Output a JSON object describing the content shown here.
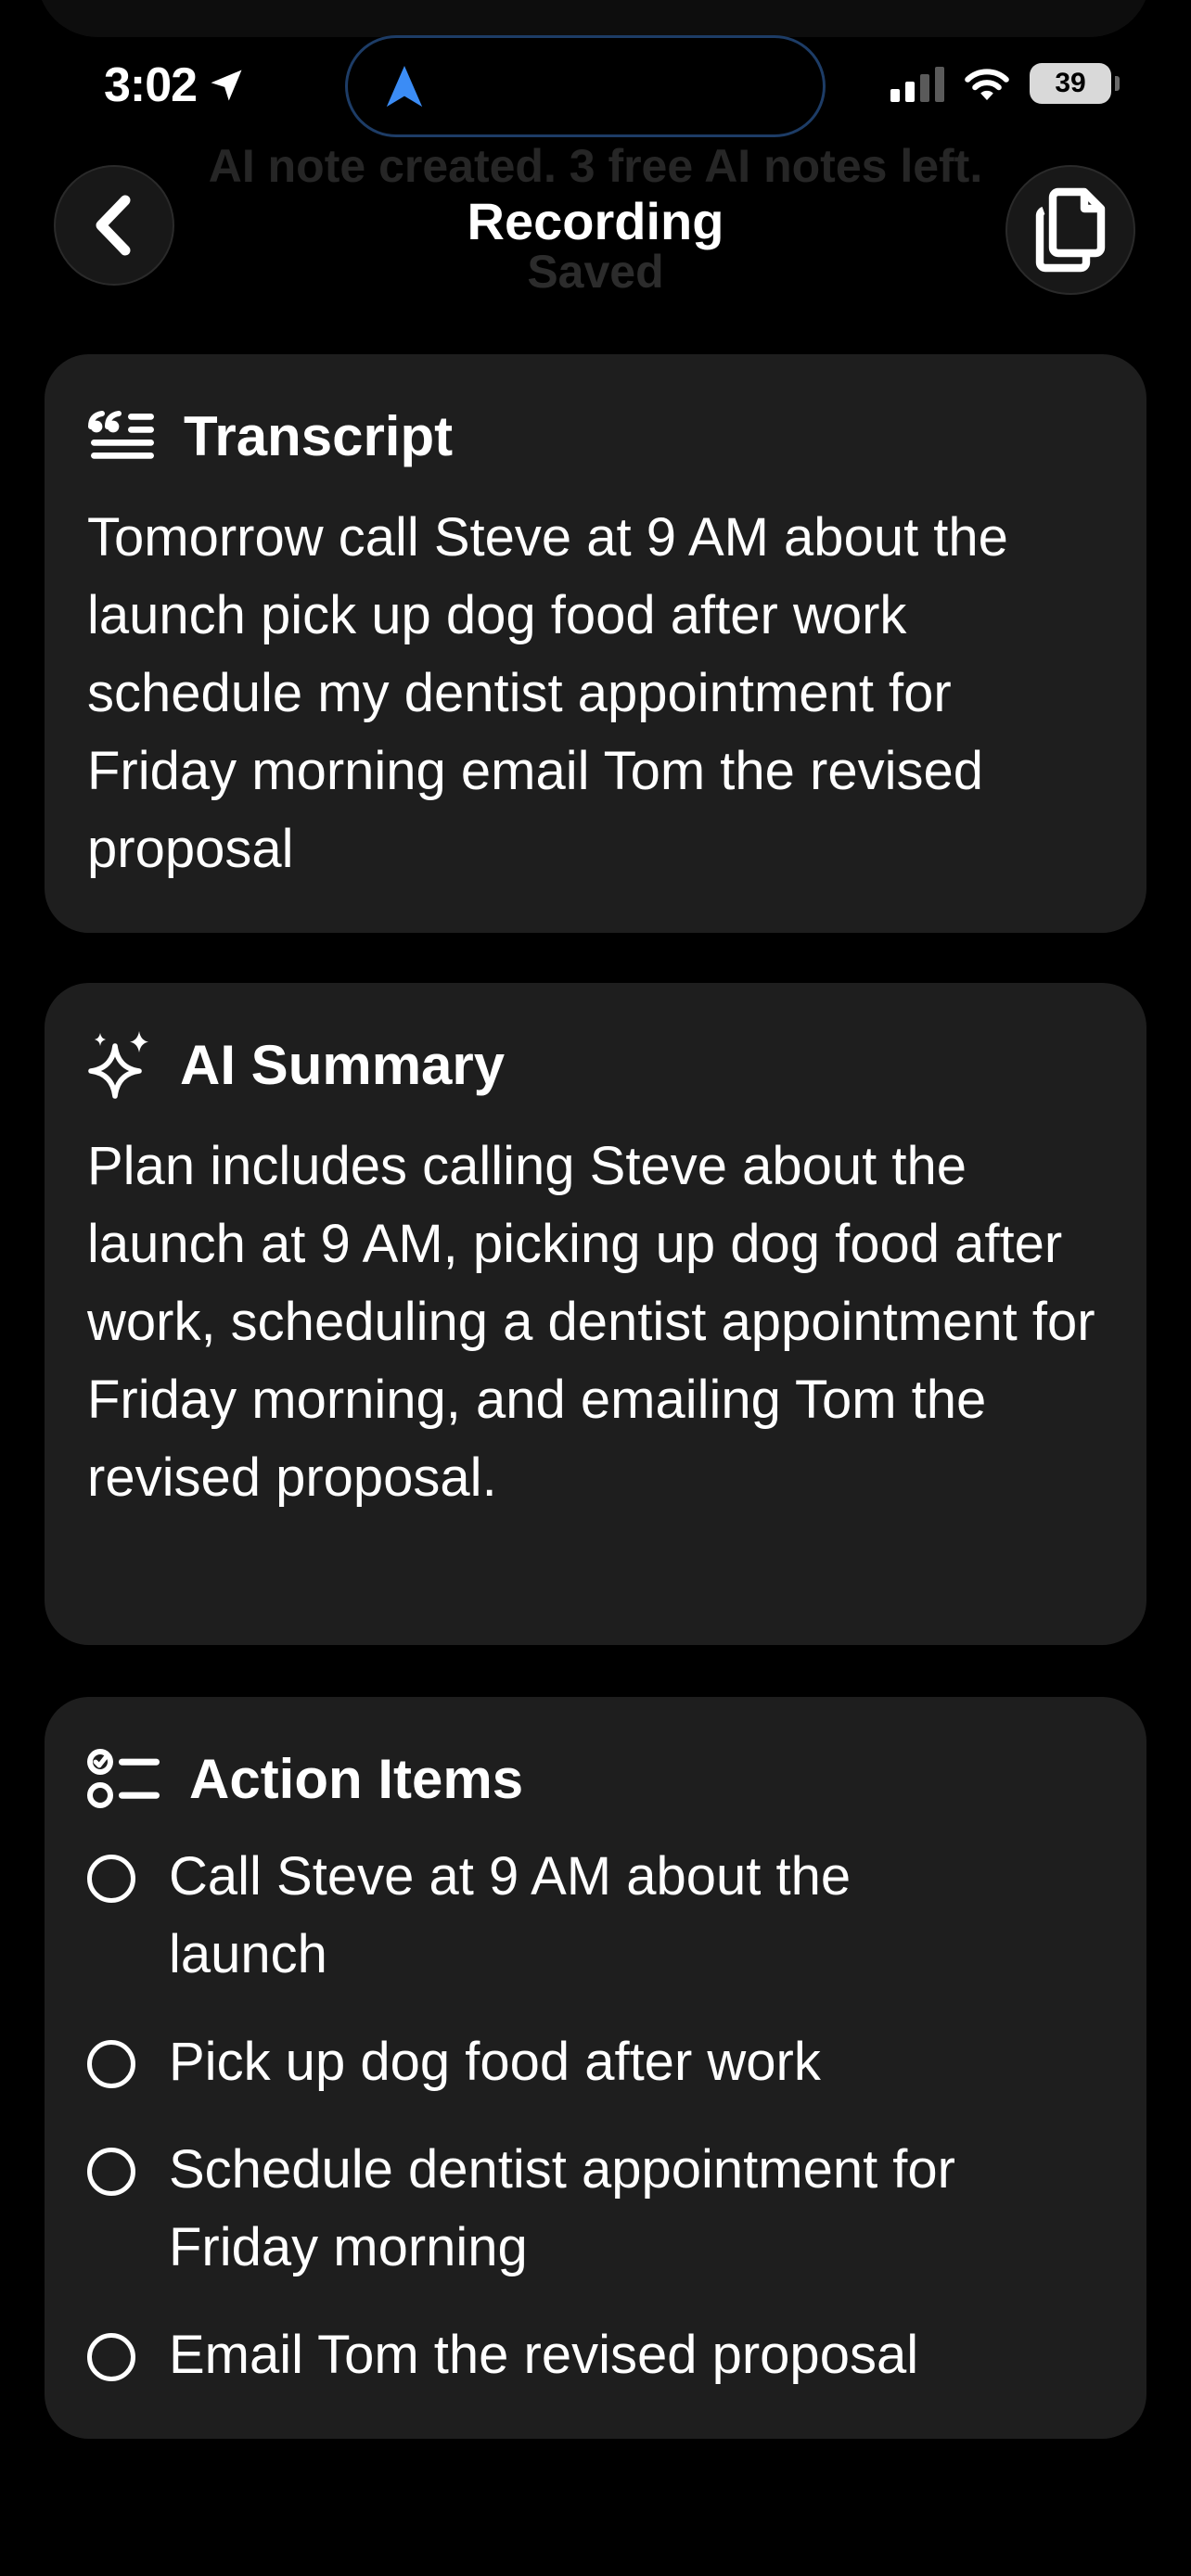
{
  "status_bar": {
    "time": "3:02",
    "battery": "39"
  },
  "background_toast": {
    "line1": "AI note created. 3 free AI notes left.",
    "line2": "Saved"
  },
  "header": {
    "title": "Recording"
  },
  "transcript": {
    "title": "Transcript",
    "text": "Tomorrow call Steve at 9 AM about the launch pick up dog food after work schedule my dentist appointment for Friday morning email Tom the revised proposal"
  },
  "summary": {
    "title": "AI Summary",
    "text": "Plan includes calling Steve about the launch at 9 AM, picking up dog food after work, scheduling a dentist appointment for Friday morning, and emailing Tom the revised proposal."
  },
  "actions": {
    "title": "Action Items",
    "items": [
      {
        "label": "Call Steve at 9 AM about the launch",
        "checked": false
      },
      {
        "label": "Pick up dog food after work",
        "checked": false
      },
      {
        "label": "Schedule dentist appointment for Friday morning",
        "checked": false
      },
      {
        "label": "Email Tom the revised proposal",
        "checked": false
      }
    ]
  },
  "icons": {
    "back": "chevron-left-icon",
    "copy": "copy-icon",
    "transcript": "quote-lines-icon",
    "summary": "sparkles-icon",
    "actions": "checklist-icon",
    "location": "location-arrow-icon",
    "navigation": "navigation-arrow-icon"
  },
  "colors": {
    "background": "#000000",
    "card": "#1e1e1e",
    "text": "#ffffff",
    "island_border": "#1d3c66",
    "nav_accent": "#3b8cf5"
  }
}
